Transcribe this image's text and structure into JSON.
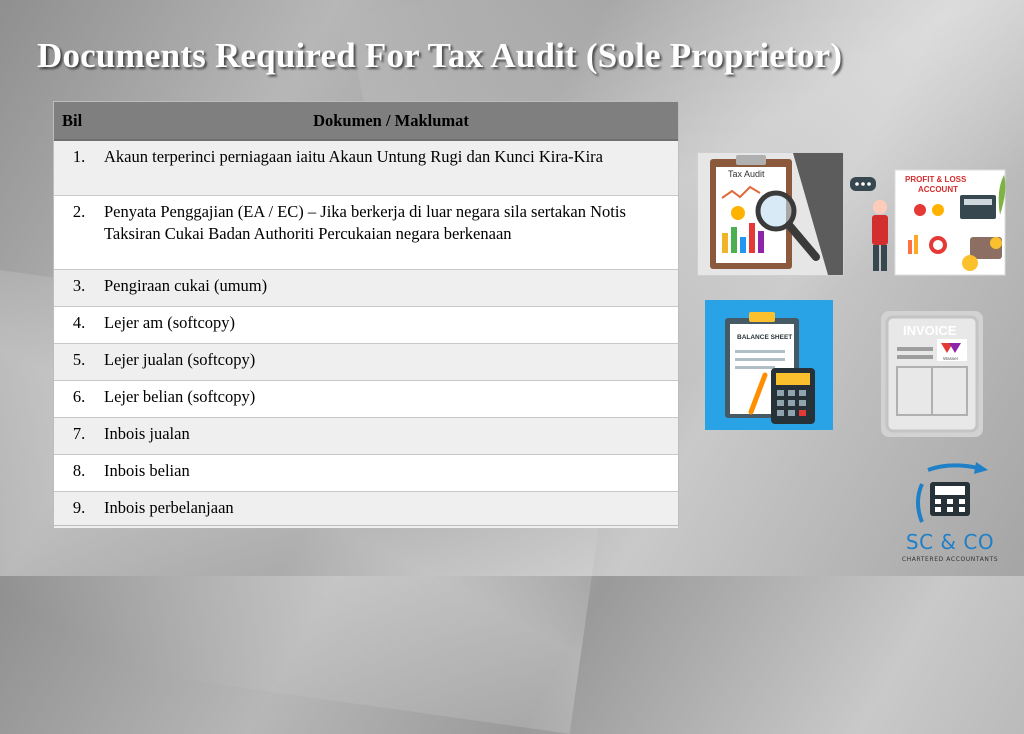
{
  "slide": {
    "title": "Documents Required For Tax Audit (Sole Proprietor)"
  },
  "table": {
    "headers": [
      "Bil",
      "Dokumen / Maklumat"
    ],
    "rows": [
      {
        "num": "1.",
        "text": "Akaun terperinci perniagaan iaitu Akaun Untung Rugi dan Kunci Kira-Kira"
      },
      {
        "num": "2.",
        "text": "Penyata Penggajian (EA / EC) – Jika berkerja di luar negara sila sertakan Notis Taksiran Cukai Badan Authoriti Percukaian negara berkenaan"
      },
      {
        "num": "3.",
        "text": "Pengiraan cukai (umum)"
      },
      {
        "num": "4.",
        "text": "Lejer am (softcopy)"
      },
      {
        "num": "5.",
        "text": "Lejer jualan (softcopy)"
      },
      {
        "num": "6.",
        "text": "Lejer belian (softcopy)"
      },
      {
        "num": "7.",
        "text": "Inbois jualan"
      },
      {
        "num": "8.",
        "text": "Inbois belian"
      },
      {
        "num": "9.",
        "text": "Inbois perbelanjaan"
      }
    ]
  },
  "illustrations": {
    "tax_audit_label": "Tax Audit",
    "pl_label_1": "PROFIT & LOSS",
    "pl_label_2": "ACCOUNT",
    "balance_label": "BALANCE SHEET",
    "invoice_label": "INVOICE",
    "invoice_brand": "Wasser"
  },
  "logo": {
    "name": "SC & CO",
    "subtitle": "CHARTERED ACCOUNTANTS"
  },
  "colors": {
    "header_bg": "#7f7f7f",
    "row_alt": "#efefef",
    "accent_blue": "#29a3e6",
    "logo_blue": "#1f7fc7"
  }
}
